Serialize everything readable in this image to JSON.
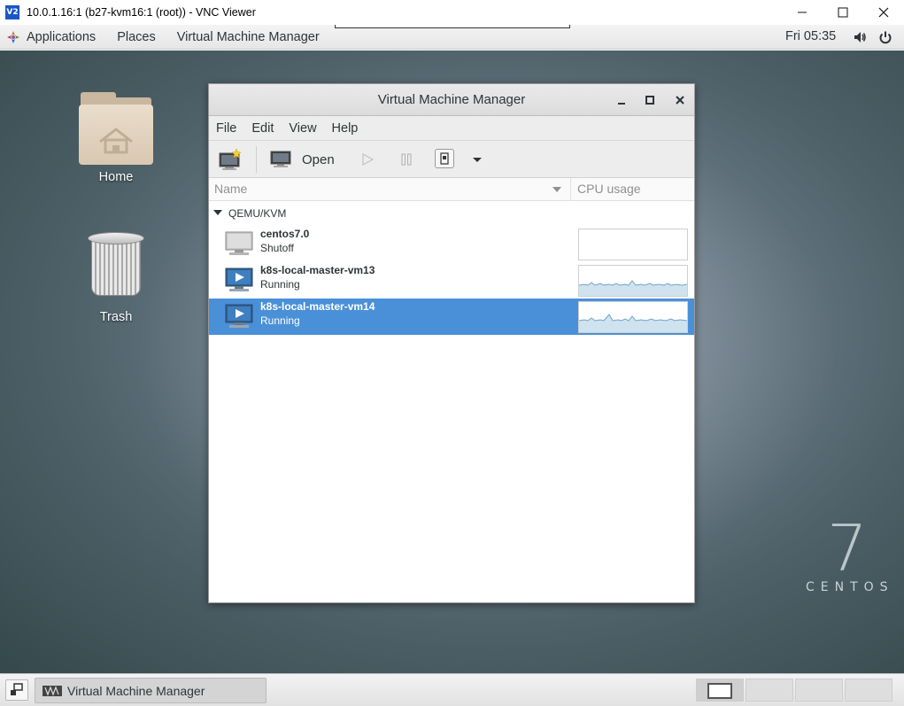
{
  "vnc": {
    "logo_text": "V2",
    "title": "10.0.1.16:1 (b27-kvm16:1 (root)) - VNC Viewer"
  },
  "topbar": {
    "applications": "Applications",
    "places": "Places",
    "vmm": "Virtual Machine Manager",
    "clock": "Fri 05:35"
  },
  "desktop": {
    "home_label": "Home",
    "trash_label": "Trash",
    "brand_number": "7",
    "brand_word": "CENTOS"
  },
  "vmm_window": {
    "title": "Virtual Machine Manager",
    "menu": [
      "File",
      "Edit",
      "View",
      "Help"
    ],
    "toolbar": {
      "open_label": "Open"
    },
    "columns": {
      "name": "Name",
      "cpu": "CPU usage"
    },
    "group": "QEMU/KVM",
    "vms": [
      {
        "name": "centos7.0",
        "status": "Shutoff",
        "selected": false
      },
      {
        "name": "k8s-local-master-vm13",
        "status": "Running",
        "selected": false
      },
      {
        "name": "k8s-local-master-vm14",
        "status": "Running",
        "selected": true
      }
    ]
  },
  "taskbar": {
    "task_label": "Virtual Machine Manager"
  },
  "colors": {
    "selection": "#4a90d9",
    "cpu_line": "#6da3c8",
    "cpu_fill": "#cfe3ef"
  }
}
